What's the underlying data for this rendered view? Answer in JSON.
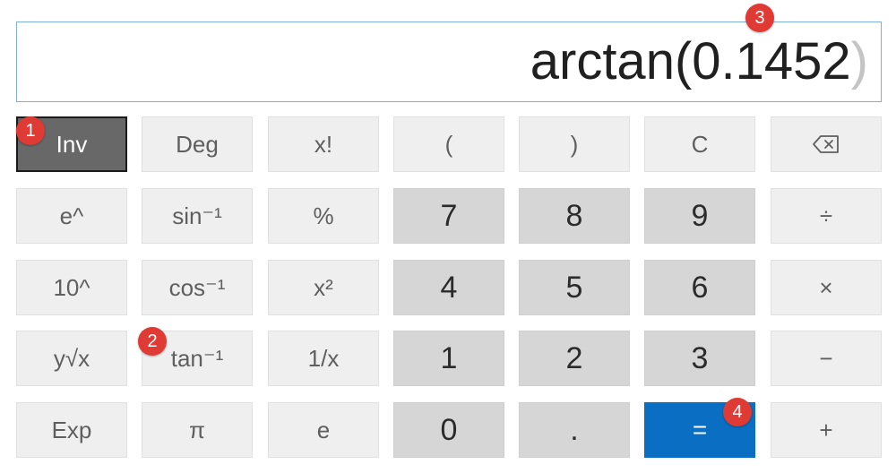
{
  "display": {
    "expression": "arctan(0.1452",
    "ghost_paren": ")"
  },
  "keys": {
    "inv": "Inv",
    "deg": "Deg",
    "fact": "x!",
    "lparen": "(",
    "rparen": ")",
    "clear": "C",
    "backspace_icon": "backspace-icon",
    "exp": "e^",
    "asin": "sin⁻¹",
    "percent": "%",
    "n7": "7",
    "n8": "8",
    "n9": "9",
    "divide": "÷",
    "pow10": "10^",
    "acos": "cos⁻¹",
    "square": "x²",
    "n4": "4",
    "n5": "5",
    "n6": "6",
    "multiply": "×",
    "root": "y√x",
    "atan": "tan⁻¹",
    "reciprocal": "1/x",
    "n1": "1",
    "n2": "2",
    "n3": "3",
    "minus": "−",
    "sci": "Exp",
    "pi": "π",
    "e": "e",
    "n0": "0",
    "dot": ".",
    "equals": "=",
    "plus": "+"
  },
  "badges": {
    "b1": "1",
    "b2": "2",
    "b3": "3",
    "b4": "4"
  },
  "colors": {
    "equals_bg": "#0a6fc2",
    "badge_bg": "#e03a34",
    "inv_active_bg": "#686868"
  }
}
